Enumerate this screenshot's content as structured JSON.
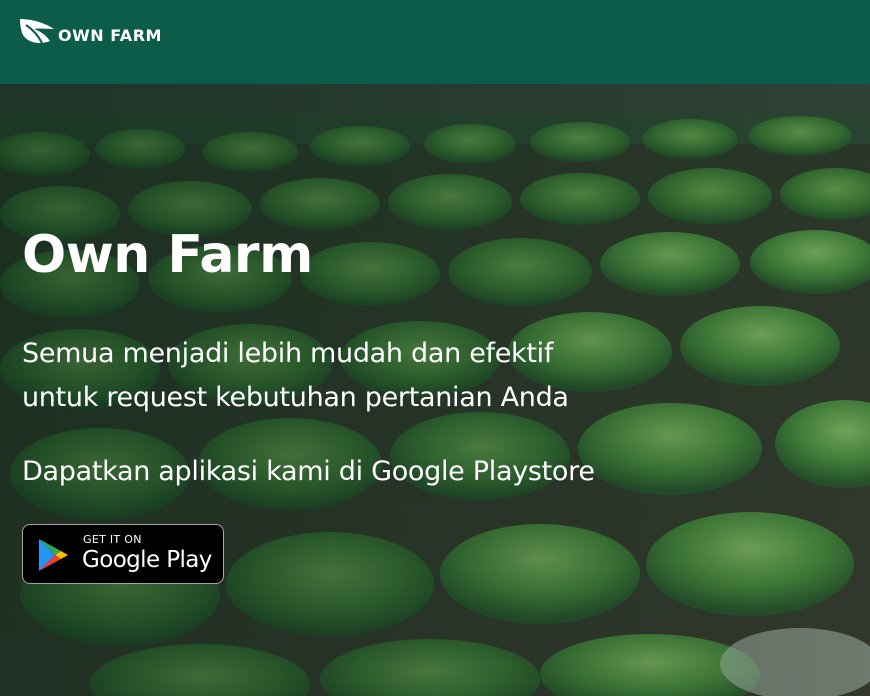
{
  "navbar": {
    "brand_text": "OWN FARM",
    "logo_icon": "leaf-logo-icon"
  },
  "hero": {
    "title": "Own Farm",
    "description_lines": [
      "Semua menjadi lebih mudah dan efektif",
      "untuk request kebutuhan pertanian Anda"
    ],
    "cta_text": "Dapatkan aplikasi kami di Google Playstore",
    "background": "lettuce-field-photo"
  },
  "play_badge": {
    "small_text": "GET IT ON",
    "big_text": "Google Play",
    "icon": "google-play-icon"
  },
  "colors": {
    "navbar_bg": "#0b5d4a",
    "text": "#ffffff",
    "badge_bg": "#000000",
    "badge_border": "#a6a6a6"
  }
}
